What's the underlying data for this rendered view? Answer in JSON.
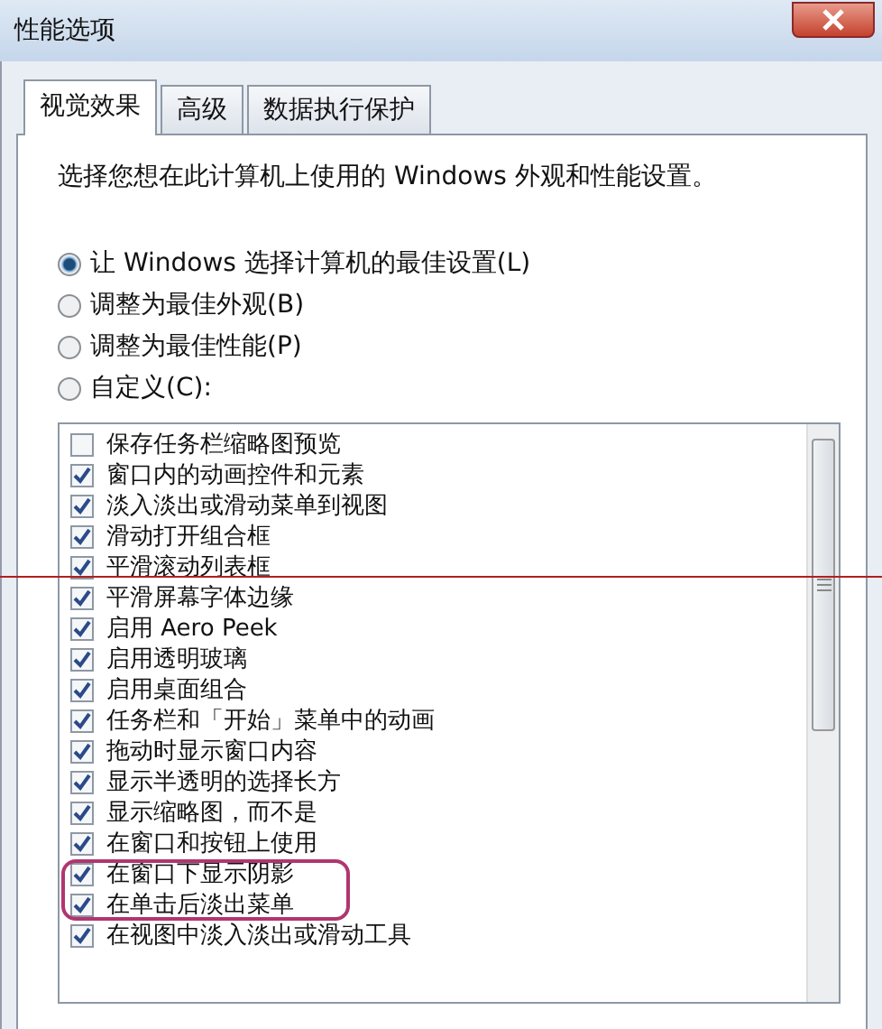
{
  "window": {
    "title": "性能选项"
  },
  "tabs": [
    {
      "label": "视觉效果",
      "selected": true
    },
    {
      "label": "高级",
      "selected": false
    },
    {
      "label": "数据执行保护",
      "selected": false
    }
  ],
  "intro": "选择您想在此计算机上使用的 Windows 外观和性能设置。",
  "options": [
    {
      "label": "让 Windows 选择计算机的最佳设置(L)",
      "selected": true
    },
    {
      "label": "调整为最佳外观(B)",
      "selected": false
    },
    {
      "label": "调整为最佳性能(P)",
      "selected": false
    },
    {
      "label": "自定义(C):",
      "selected": false
    }
  ],
  "effects": [
    {
      "label": "保存任务栏缩略图预览",
      "checked": false
    },
    {
      "label": "窗口内的动画控件和元素",
      "checked": true
    },
    {
      "label": "淡入淡出或滑动菜单到视图",
      "checked": true
    },
    {
      "label": "滑动打开组合框",
      "checked": true
    },
    {
      "label": "平滑滚动列表框",
      "checked": true
    },
    {
      "label": "平滑屏幕字体边缘",
      "checked": true
    },
    {
      "label": "启用 Aero Peek",
      "checked": true
    },
    {
      "label": "启用透明玻璃",
      "checked": true
    },
    {
      "label": "启用桌面组合",
      "checked": true
    },
    {
      "label": "任务栏和「开始」菜单中的动画",
      "checked": true
    },
    {
      "label": "拖动时显示窗口内容",
      "checked": true
    },
    {
      "label": "显示半透明的选择长方",
      "checked": true
    },
    {
      "label": "显示缩略图，而不是",
      "checked": true
    },
    {
      "label": "在窗口和按钮上使用",
      "checked": true
    },
    {
      "label": "在窗口下显示阴影",
      "checked": true,
      "highlighted": true
    },
    {
      "label": "在单击后淡出菜单",
      "checked": true,
      "highlighted": true
    },
    {
      "label": "在视图中淡入淡出或滑动工具",
      "checked": true
    }
  ]
}
